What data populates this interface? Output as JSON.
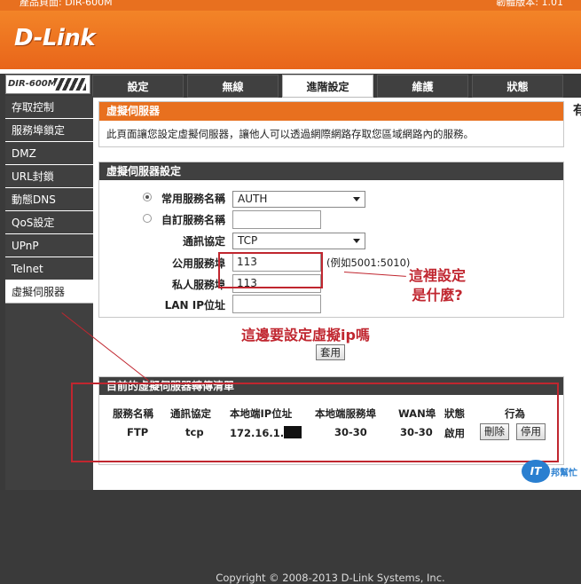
{
  "header": {
    "top_left": "產品頁面: DIR-600M",
    "top_right": "韌體版本: 1.01",
    "logo": "D-Link",
    "model": "DIR-600M"
  },
  "nav": {
    "tabs": [
      {
        "label": "設定",
        "active": false
      },
      {
        "label": "無線",
        "active": false
      },
      {
        "label": "進階設定",
        "active": true
      },
      {
        "label": "維護",
        "active": false
      },
      {
        "label": "狀態",
        "active": false
      }
    ]
  },
  "sidebar": {
    "items": [
      {
        "label": "存取控制",
        "active": false
      },
      {
        "label": "服務埠鎖定",
        "active": false
      },
      {
        "label": "DMZ",
        "active": false
      },
      {
        "label": "URL封鎖",
        "active": false
      },
      {
        "label": "動態DNS",
        "active": false
      },
      {
        "label": "QoS設定",
        "active": false
      },
      {
        "label": "UPnP",
        "active": false
      },
      {
        "label": "Telnet",
        "active": false
      },
      {
        "label": "虛擬伺服器",
        "active": true
      }
    ]
  },
  "intro": {
    "title": "虛擬伺服器",
    "description": "此頁面讓您設定虛擬伺服器，讓他人可以透過網際網路存取您區域網路內的服務。"
  },
  "settings": {
    "title": "虛擬伺服器設定",
    "common_service_label": "常用服務名稱",
    "common_service_value": "AUTH",
    "custom_service_label": "自訂服務名稱",
    "custom_service_value": "",
    "protocol_label": "通訊協定",
    "protocol_value": "TCP",
    "public_port_label": "公用服務埠",
    "public_port_value": "113",
    "public_port_hint": "(例如5001:5010)",
    "private_port_label": "私人服務埠",
    "private_port_value": "113",
    "lan_ip_label": "LAN IP位址",
    "lan_ip_value": "",
    "apply_label": "套用"
  },
  "list": {
    "title": "目前的虛擬伺服器轉傳清單",
    "headers": [
      "服務名稱",
      "通訊協定",
      "本地端IP位址",
      "本地端服務埠",
      "WAN埠",
      "狀態",
      "行為"
    ],
    "rows": [
      {
        "service": "FTP",
        "protocol": "tcp",
        "ip": "172.16.1.",
        "local_port": "30-30",
        "wan_port": "30-30",
        "status": "啟用",
        "delete_label": "刪除",
        "disable_label": "停用"
      }
    ]
  },
  "footer": {
    "copyright": "Copyright © 2008-2013 D-Link Systems, Inc."
  },
  "right_panel": {
    "title": "有"
  },
  "annotations": {
    "question": "這裡設定\n是什麼?",
    "virtual_ip_question": "這邊要設定虛擬ip嗎",
    "color": "#c0262f"
  },
  "watermark": {
    "circle": "IT",
    "text": "邦幫忙"
  }
}
